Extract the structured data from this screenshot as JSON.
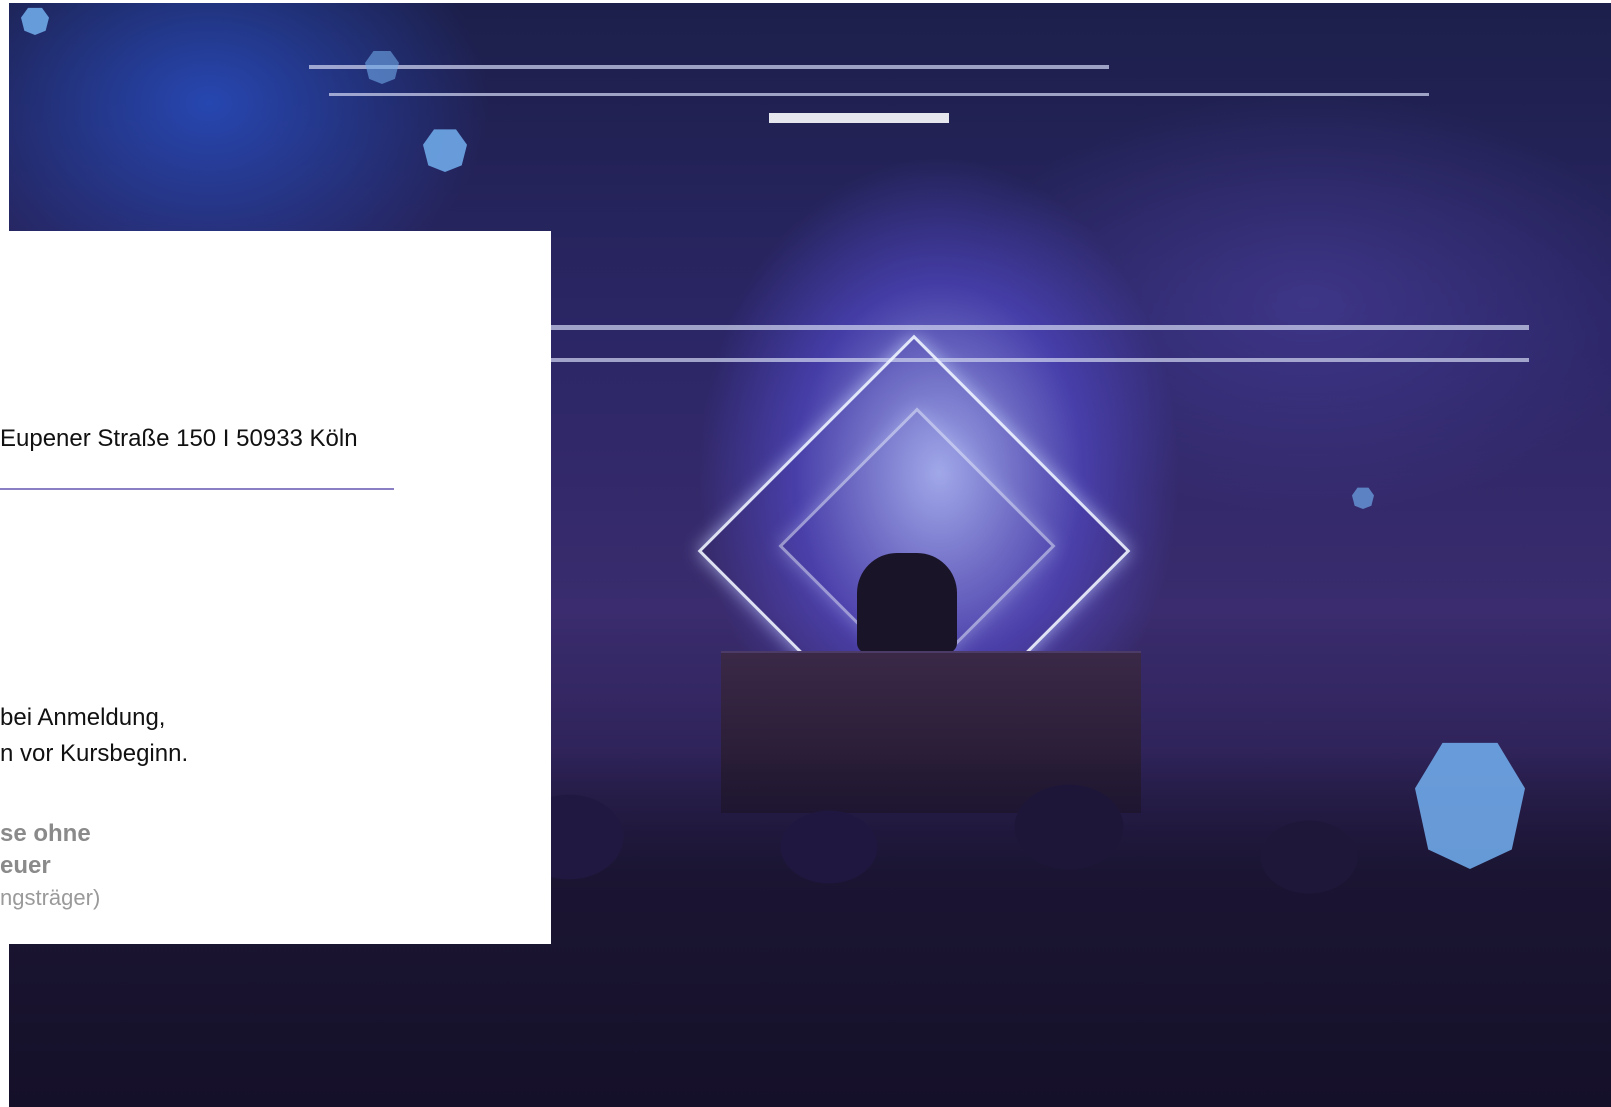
{
  "venue": {
    "address": "Eupener Straße 150 I 50933 Köln"
  },
  "payment": {
    "line1": "bei Anmeldung,",
    "line2": "n vor Kursbeginn."
  },
  "pricing": {
    "line1": "se ohne",
    "line2": "euer",
    "line3": "ngsträger)"
  },
  "colors": {
    "divider": "#8a7fc4",
    "hexagon": "#6fa8e8"
  }
}
